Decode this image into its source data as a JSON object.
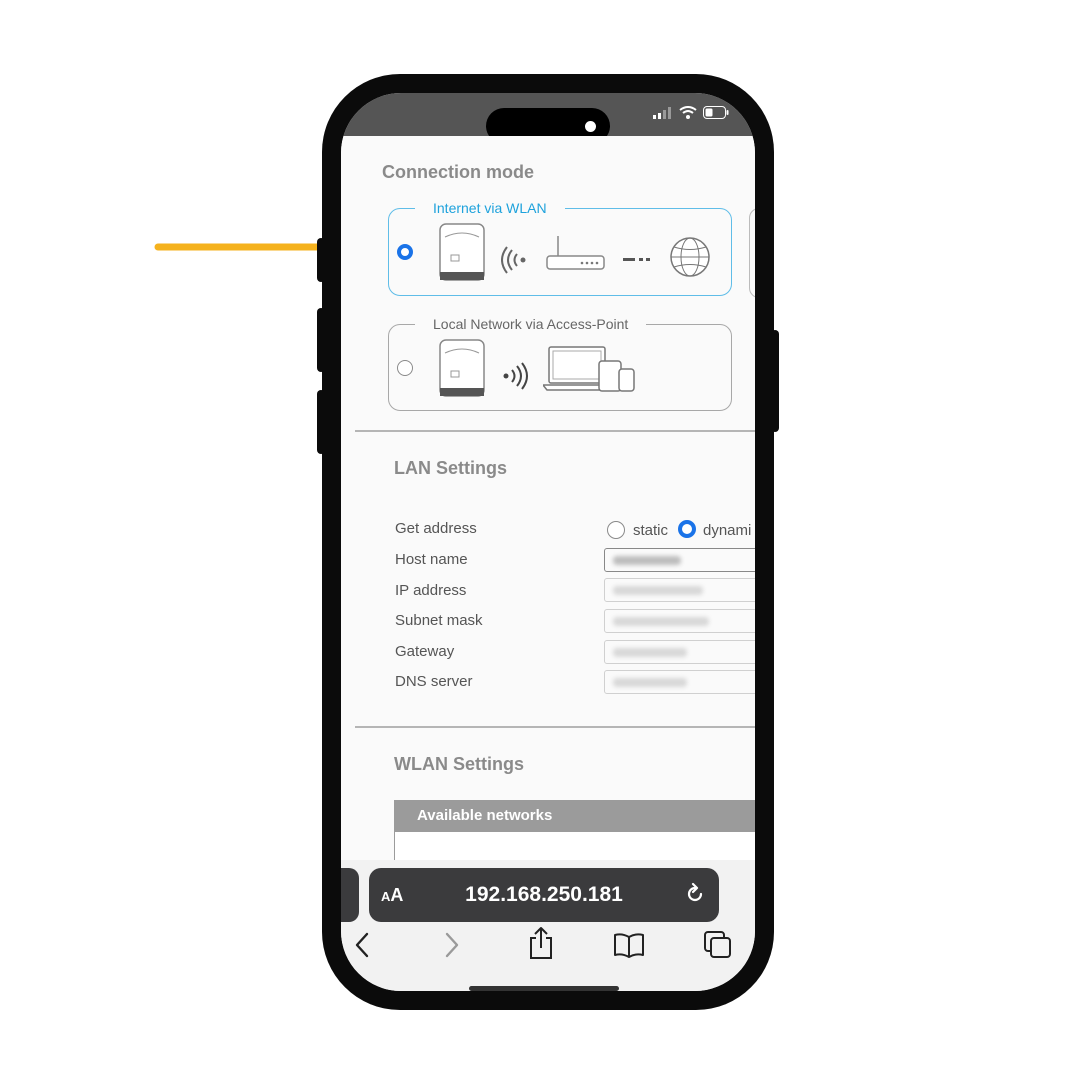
{
  "connection": {
    "title": "Connection mode",
    "option_wlan": {
      "label": "Internet via WLAN",
      "selected": true
    },
    "option_ap": {
      "label": "Local Network via Access-Point",
      "selected": false
    }
  },
  "lan": {
    "title": "LAN Settings",
    "get_address_label": "Get address",
    "opt_static": "static",
    "opt_dynamic": "dynami",
    "selected_option": "dynamic",
    "fields": [
      {
        "label": "Host name"
      },
      {
        "label": "IP address"
      },
      {
        "label": "Subnet mask"
      },
      {
        "label": "Gateway"
      },
      {
        "label": "DNS server"
      }
    ]
  },
  "wlan": {
    "title": "WLAN Settings",
    "table_header": "Available networks"
  },
  "browser": {
    "aa_label_small": "A",
    "aa_label_big": "A",
    "url": "192.168.250.181"
  },
  "colors": {
    "accent_arrow": "#f5b21e",
    "selected_blue": "#1ea2dc",
    "radio_blue": "#1a73e8"
  },
  "icons": [
    "inverter-icon",
    "wifi-waves-icon",
    "router-icon",
    "globe-icon",
    "devices-icon",
    "reload-icon",
    "back-icon",
    "forward-icon",
    "share-icon",
    "bookmarks-icon",
    "tabs-icon"
  ]
}
